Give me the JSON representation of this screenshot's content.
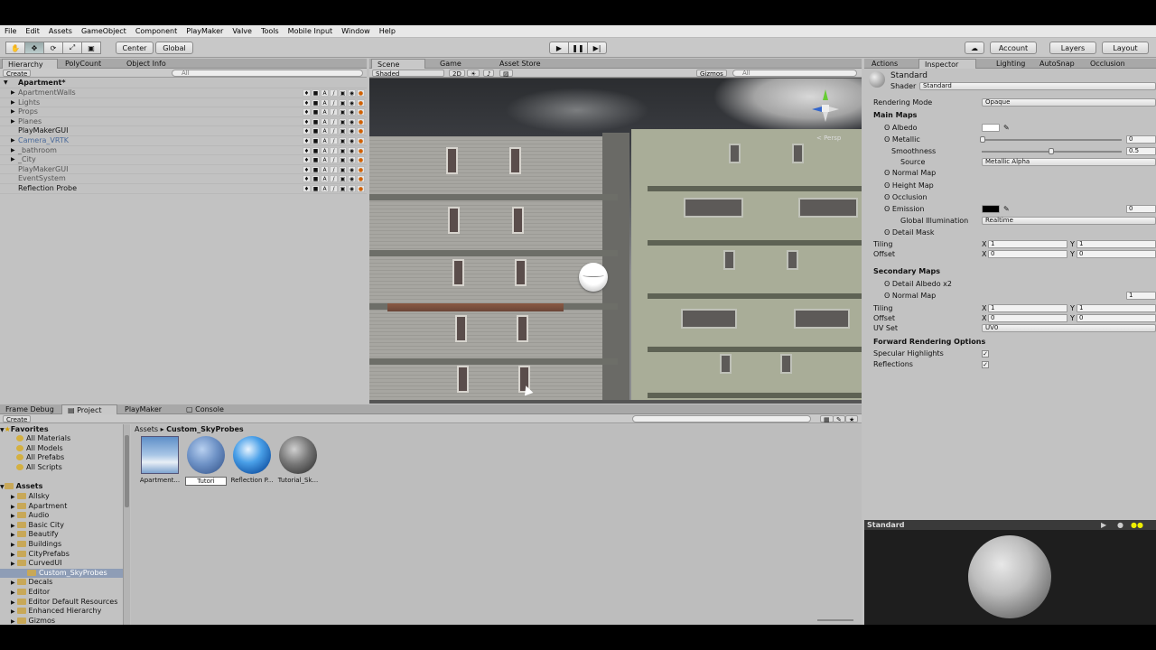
{
  "menu": [
    "File",
    "Edit",
    "Assets",
    "GameObject",
    "Component",
    "PlayMaker",
    "Valve",
    "Tools",
    "Mobile Input",
    "Window",
    "Help"
  ],
  "toolbar": {
    "pivot": "Center",
    "space": "Global",
    "account": "Account",
    "layers": "Layers",
    "layout": "Layout"
  },
  "hierarchy": {
    "tabs": [
      "Hierarchy",
      "PolyCount",
      "Object Info"
    ],
    "create": "Create",
    "search": "All",
    "scene": "Apartment*",
    "items": [
      {
        "label": "ApartmentWalls",
        "arrow": true
      },
      {
        "label": "Lights",
        "arrow": true
      },
      {
        "label": "Props",
        "arrow": true
      },
      {
        "label": "Planes",
        "arrow": true
      },
      {
        "label": "PlayMakerGUI",
        "arrow": false
      },
      {
        "label": "Camera_VRTK",
        "arrow": true
      },
      {
        "label": "_bathroom",
        "arrow": true
      },
      {
        "label": "_City",
        "arrow": true
      },
      {
        "label": "PlayMakerGUI",
        "arrow": false
      },
      {
        "label": "EventSystem",
        "arrow": false
      },
      {
        "label": "Reflection Probe",
        "arrow": false
      }
    ]
  },
  "scene": {
    "tabs": [
      "Scene",
      "Game",
      "Asset Store"
    ],
    "shading": "Shaded",
    "mode2d": "2D",
    "gizmos": "Gizmos",
    "search": "All",
    "persp": "< Persp"
  },
  "inspector": {
    "tabs": [
      "Actions",
      "Inspector",
      "Lighting",
      "AutoSnap",
      "Occlusion"
    ],
    "material": "Standard",
    "shader_label": "Shader",
    "shader_value": "Standard",
    "rendering_mode_label": "Rendering Mode",
    "rendering_mode_value": "Opaque",
    "main_maps": "Main Maps",
    "albedo": "Albedo",
    "metallic": "Metallic",
    "metallic_value": "0",
    "smoothness": "Smoothness",
    "smoothness_value": "0.5",
    "source": "Source",
    "source_value": "Metallic Alpha",
    "normal_map": "Normal Map",
    "height_map": "Height Map",
    "occlusion": "Occlusion",
    "emission": "Emission",
    "emission_value": "0",
    "global_illumination": "Global Illumination",
    "gi_value": "Realtime",
    "detail_mask": "Detail Mask",
    "tiling": "Tiling",
    "offset": "Offset",
    "tiling_x": "1",
    "tiling_y": "1",
    "offset_x": "0",
    "offset_y": "0",
    "secondary_maps": "Secondary Maps",
    "detail_albedo": "Detail Albedo x2",
    "normal_map2": "Normal Map",
    "normal_map2_value": "1",
    "tiling2_x": "1",
    "tiling2_y": "1",
    "offset2_x": "0",
    "offset2_y": "0",
    "uv_set": "UV Set",
    "uv_set_value": "UV0",
    "forward_options": "Forward Rendering Options",
    "specular_highlights": "Specular Highlights",
    "reflections": "Reflections",
    "preview_title": "Standard",
    "x": "X",
    "y": "Y"
  },
  "bottom": {
    "tabs": [
      "Frame Debug",
      "Project",
      "PlayMaker",
      "Console"
    ],
    "create": "Create",
    "favorites_title": "Favorites",
    "favorites": [
      "All Materials",
      "All Models",
      "All Prefabs",
      "All Scripts"
    ],
    "assets_title": "Assets",
    "folders": [
      "Allsky",
      "Apartment",
      "Audio",
      "Basic City",
      "Beautify",
      "Buildings",
      "CityPrefabs",
      "CurvedUI",
      "Custom_SkyProbes",
      "Decals",
      "Editor",
      "Editor Default Resources",
      "Enhanced Hierarchy",
      "Gizmos"
    ],
    "selected_folder": "Custom_SkyProbes",
    "breadcrumb_root": "Assets",
    "breadcrumb_sep": "▸",
    "breadcrumb_current": "Custom_SkyProbes",
    "assets": [
      "Apartment...",
      "Tutori",
      "Reflection P...",
      "Tutorial_Sk..."
    ]
  }
}
